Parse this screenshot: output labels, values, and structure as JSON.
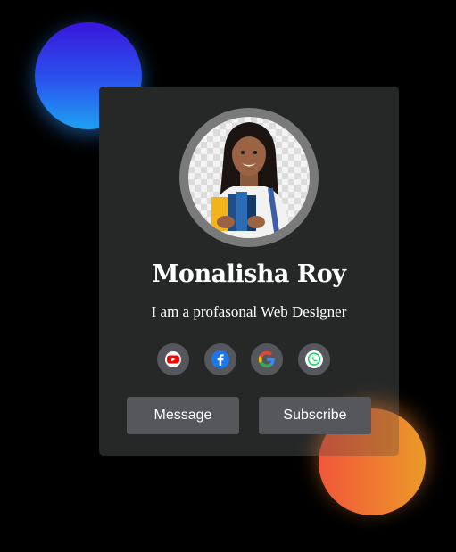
{
  "profile": {
    "name": "Monalisha Roy",
    "tagline": "I am a profasonal Web Designer"
  },
  "social": [
    {
      "icon": "youtube-icon",
      "color": "#ff0000"
    },
    {
      "icon": "facebook-icon",
      "color": "#1877f2"
    },
    {
      "icon": "google-icon",
      "color": "#4285f4"
    },
    {
      "icon": "whatsapp-icon",
      "color": "#25d366"
    }
  ],
  "actions": {
    "message_label": "Message",
    "subscribe_label": "Subscribe"
  },
  "colors": {
    "background": "#000000",
    "card": "#262828",
    "button": "#56575d",
    "blob_blue_top": "#3a16dc",
    "blob_blue_bottom": "#1ea2f2",
    "blob_orange_left": "#f1573a",
    "blob_orange_right": "#ea9a28"
  }
}
